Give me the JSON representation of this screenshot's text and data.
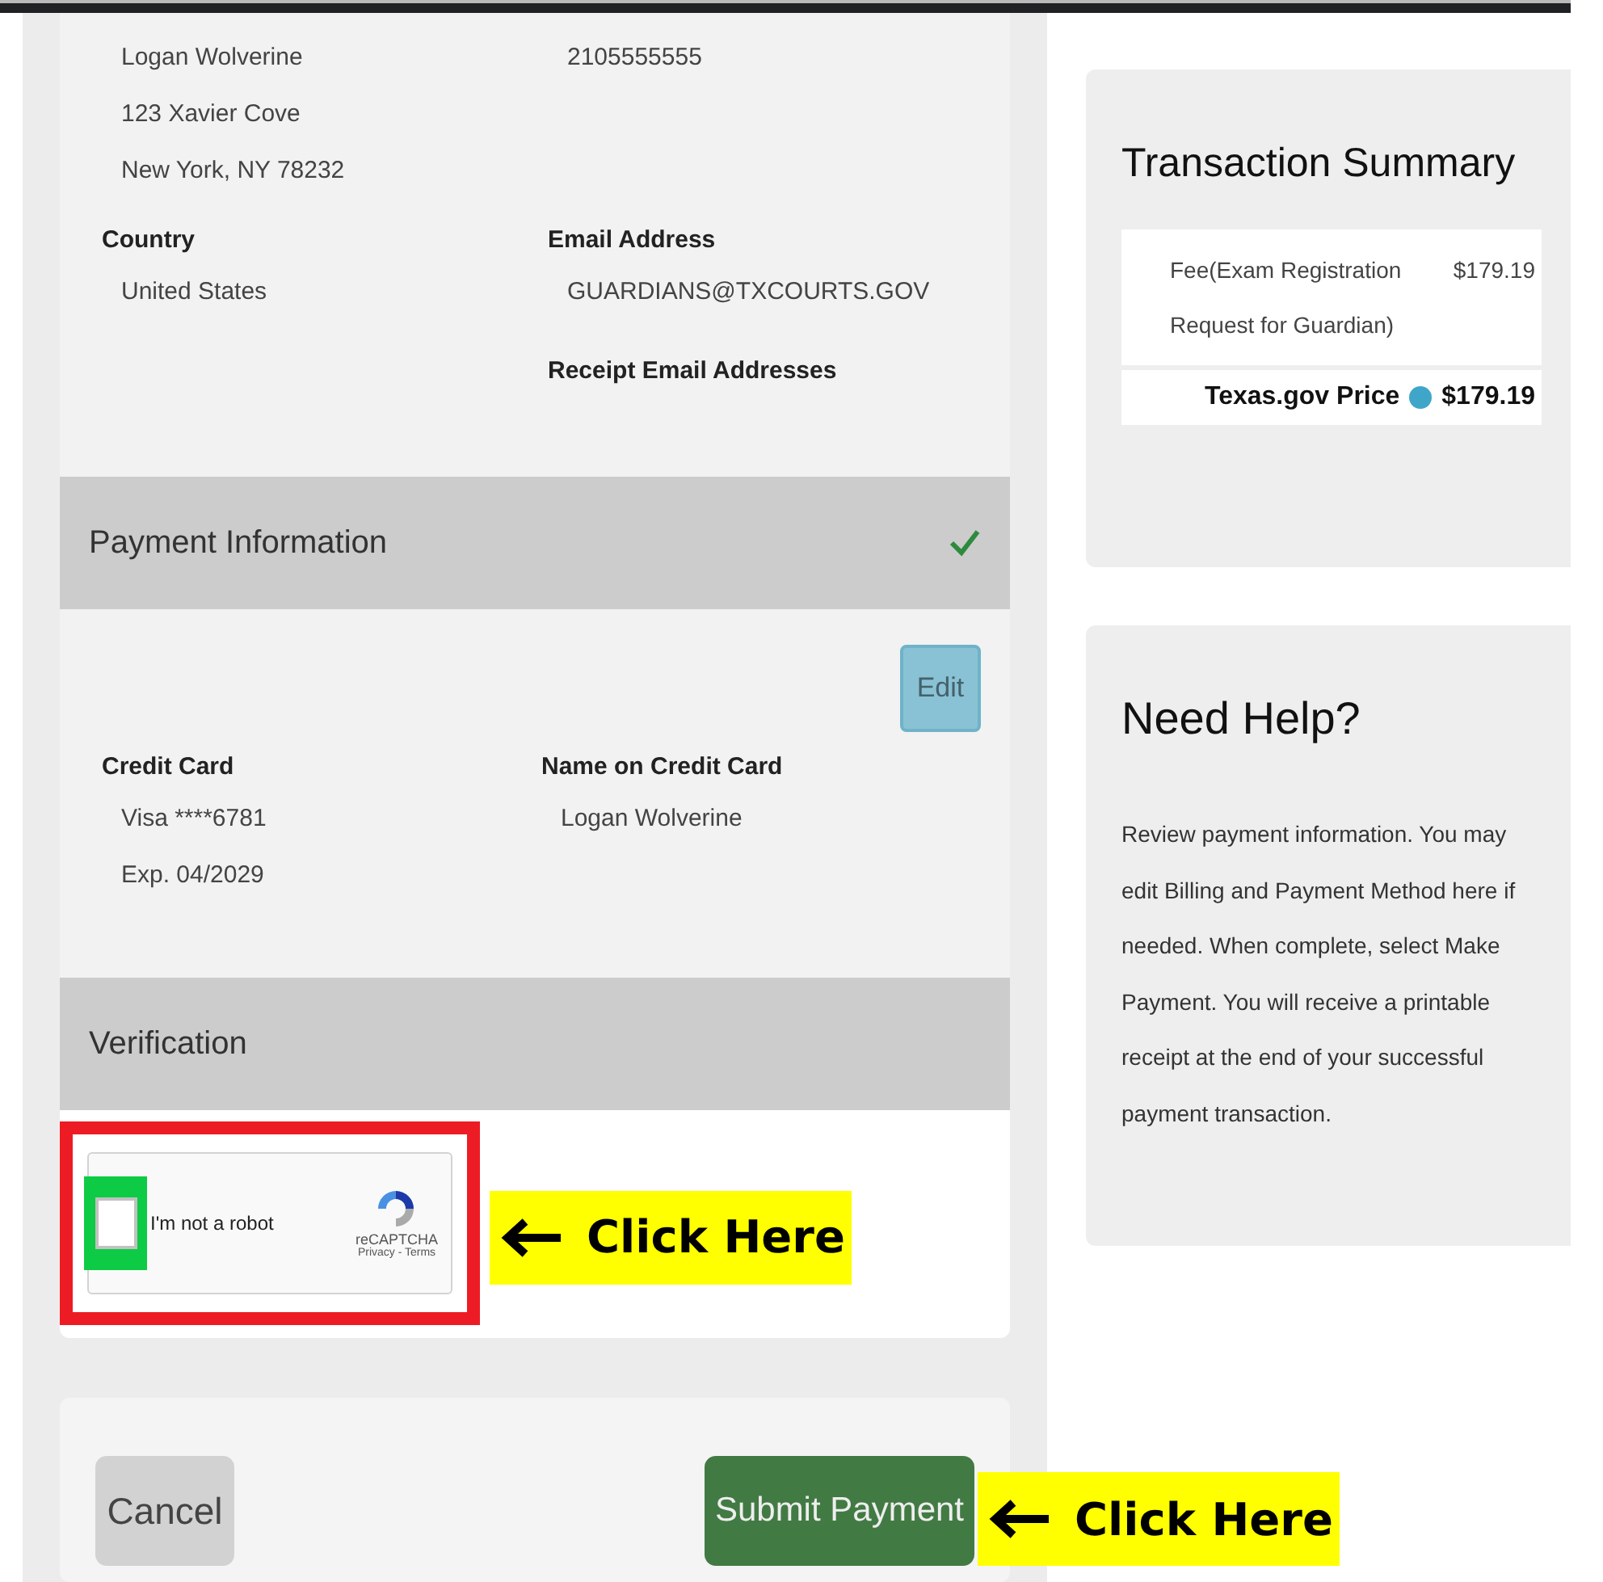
{
  "billing": {
    "address_lines": [
      "Logan Wolverine",
      "123 Xavier Cove",
      "New York, NY 78232"
    ],
    "phone": "2105555555",
    "country": {
      "label": "Country",
      "value": "United States"
    },
    "email": {
      "label": "Email Address",
      "value": "GUARDIANS@TXCOURTS.GOV"
    },
    "receipt_emails": {
      "label": "Receipt Email Addresses"
    }
  },
  "payment": {
    "title": "Payment Information",
    "complete": true,
    "edit_button": "Edit",
    "credit_card": {
      "label": "Credit Card",
      "lines": [
        "Visa ****6781",
        "Exp. 04/2029"
      ]
    },
    "name_on_card": {
      "label": "Name on Credit Card",
      "value": "Logan Wolverine"
    }
  },
  "verification": {
    "title": "Verification",
    "complete": false,
    "captcha": {
      "label": "I'm not a robot",
      "checked": false,
      "brand": "reCAPTCHA",
      "links": "Privacy - Terms"
    }
  },
  "actions": {
    "cancel": "Cancel",
    "submit": "Submit Payment"
  },
  "annotations": [
    {
      "text": "Click Here"
    },
    {
      "text": "Click Here"
    }
  ],
  "summary": {
    "title": "Transaction Summary",
    "items": [
      {
        "description": "Fee(Exam Registration Request for Guardian)",
        "amount": "$179.19"
      }
    ],
    "total": {
      "label": "Texas.gov Price",
      "amount": "$179.19"
    }
  },
  "help": {
    "title": "Need Help?",
    "text": "Review payment information. You may edit Billing and Payment Method here if needed. When complete, select Make Payment. You will receive a printable receipt at the end of your successful payment transaction."
  }
}
